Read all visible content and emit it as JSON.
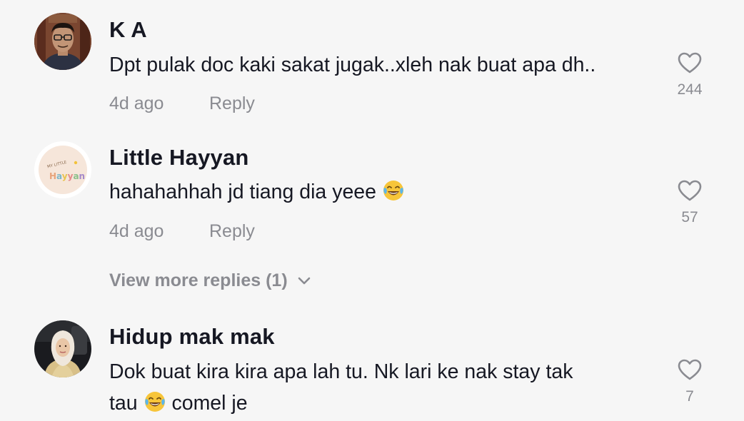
{
  "comments": [
    {
      "username": "K A",
      "text_line1": "Dpt pulak doc kaki sakat jugak..xleh nak buat apa dh..",
      "time": "4d ago",
      "reply_label": "Reply",
      "likes": "244",
      "avatar_icon": "person-photo-avatar"
    },
    {
      "username": "Little Hayyan",
      "text_before_emoji": "hahahahhah jd tiang dia yeee",
      "time": "4d ago",
      "reply_label": "Reply",
      "likes": "57",
      "avatar_logo_text_small": "MY LITTLE",
      "avatar_logo_text_main": "Hayyan",
      "emoji": "face-with-tears-of-joy"
    },
    {
      "username": "Hidup mak mak",
      "text_line1": "Dok buat kira kira apa lah tu. Nk lari ke nak stay tak",
      "text_line2_before_emoji": "tau",
      "text_line2_after_emoji": "comel je",
      "likes": "7",
      "avatar_icon": "person-hijab-photo-avatar",
      "emoji": "face-with-tears-of-joy"
    }
  ],
  "view_more_replies": "View more replies (1)",
  "colors": {
    "background": "#f6f6f6",
    "primary_text": "#161823",
    "secondary_text": "#8a8b91"
  }
}
